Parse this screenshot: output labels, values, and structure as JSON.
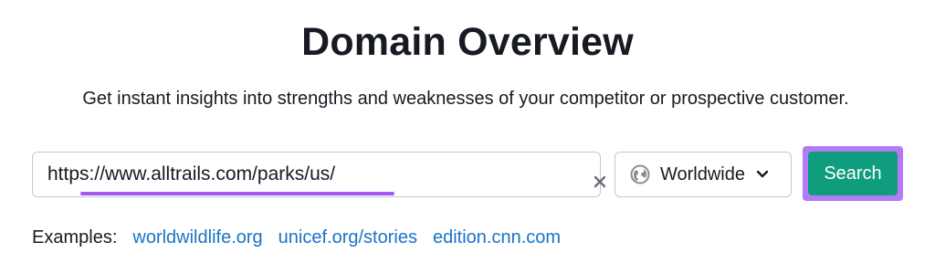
{
  "page": {
    "title": "Domain Overview",
    "subtitle": "Get instant insights into strengths and weaknesses of your competitor or prospective customer."
  },
  "search": {
    "value": "https://www.alltrails.com/parks/us/",
    "clear_icon": "close-icon",
    "database_label": "Worldwide",
    "database_icon": "globe-icon",
    "button_label": "Search"
  },
  "examples": {
    "label": "Examples:",
    "links": [
      "worldwildlife.org",
      "unicef.org/stories",
      "edition.cnn.com"
    ]
  },
  "colors": {
    "primary_button": "#0f9d7d",
    "highlight": "#a55af4",
    "link": "#1a73c8",
    "text": "#171a22"
  }
}
